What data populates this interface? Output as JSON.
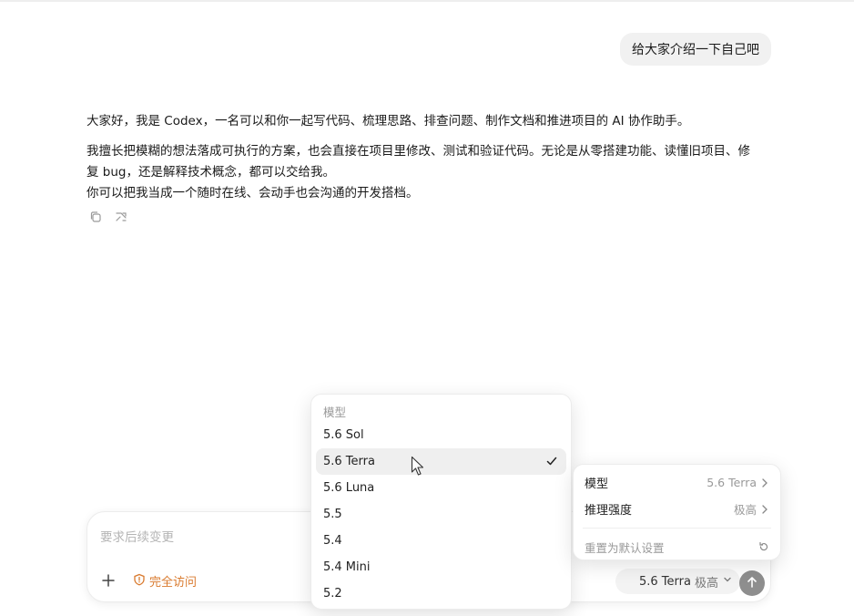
{
  "conversation": {
    "user_message": "给大家介绍一下自己吧",
    "reply": {
      "paragraph1": "大家好，我是 Codex，一名可以和你一起写代码、梳理思路、排查问题、制作文档和推进项目的 AI 协作助手。",
      "paragraph2_line1": "我擅长把模糊的想法落成可执行的方案，也会直接在项目里修改、测试和验证代码。无论是从零搭建功能、读懂旧项目、修复 bug，还是解释技术概念，都可以交给我。",
      "paragraph2_line2": "你可以把我当成一个随时在线、会动手也会沟通的开发搭档。"
    },
    "reply_actions": [
      {
        "icon": "copy-icon"
      },
      {
        "icon": "fork-icon"
      }
    ]
  },
  "composer": {
    "placeholder": "要求后续变更",
    "add_icon": "plus-icon",
    "access_icon": "shield-icon",
    "access_label": "完全访问",
    "model_pill": {
      "model": "5.6 Terra",
      "level": "极高",
      "icon": "chevron-down-icon"
    },
    "send_icon": "arrow-up-icon",
    "accent_color": "#d97a2e"
  },
  "model_menu": {
    "header": "模型",
    "options": [
      {
        "label": "5.6 Sol",
        "selected": false
      },
      {
        "label": "5.6 Terra",
        "selected": true
      },
      {
        "label": "5.6 Luna",
        "selected": false
      },
      {
        "label": "5.5",
        "selected": false
      },
      {
        "label": "5.4",
        "selected": false
      },
      {
        "label": "5.4 Mini",
        "selected": false
      },
      {
        "label": "5.2",
        "selected": false
      }
    ]
  },
  "settings_menu": {
    "model_label": "模型",
    "model_value": "5.6 Terra",
    "reasoning_label": "推理强度",
    "reasoning_value": "极高",
    "reset_label": "重置为默认设置",
    "reset_icon": "reset-icon"
  }
}
